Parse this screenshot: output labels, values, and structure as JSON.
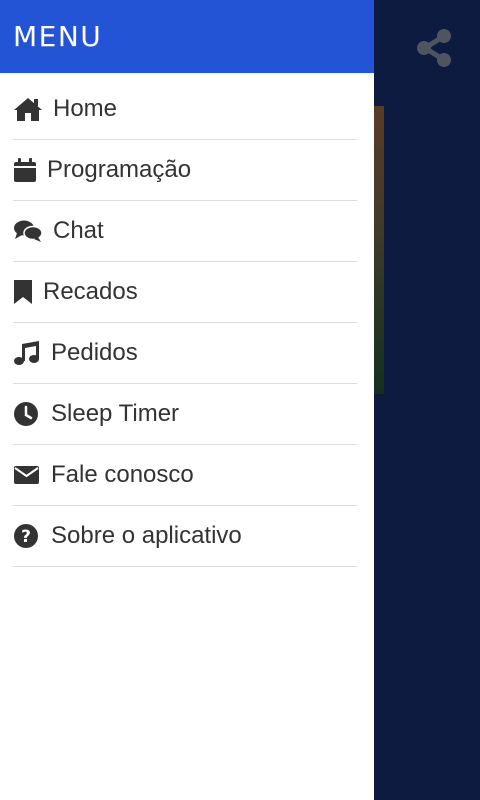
{
  "drawer": {
    "title": "MENU",
    "items": [
      {
        "label": "Home",
        "icon": "home-icon"
      },
      {
        "label": "Programação",
        "icon": "calendar-icon"
      },
      {
        "label": "Chat",
        "icon": "chat-bubbles-icon"
      },
      {
        "label": "Recados",
        "icon": "bookmark-icon"
      },
      {
        "label": "Pedidos",
        "icon": "music-note-icon"
      },
      {
        "label": "Sleep Timer",
        "icon": "clock-icon"
      },
      {
        "label": "Fale conosco",
        "icon": "envelope-icon"
      },
      {
        "label": "Sobre o aplicativo",
        "icon": "question-circle-icon"
      }
    ]
  },
  "toolbar": {
    "share_icon": "share-icon"
  },
  "colors": {
    "header": "#2354d6",
    "background": "#0d1b40",
    "icon": "#333333",
    "divider": "#dddddd"
  }
}
